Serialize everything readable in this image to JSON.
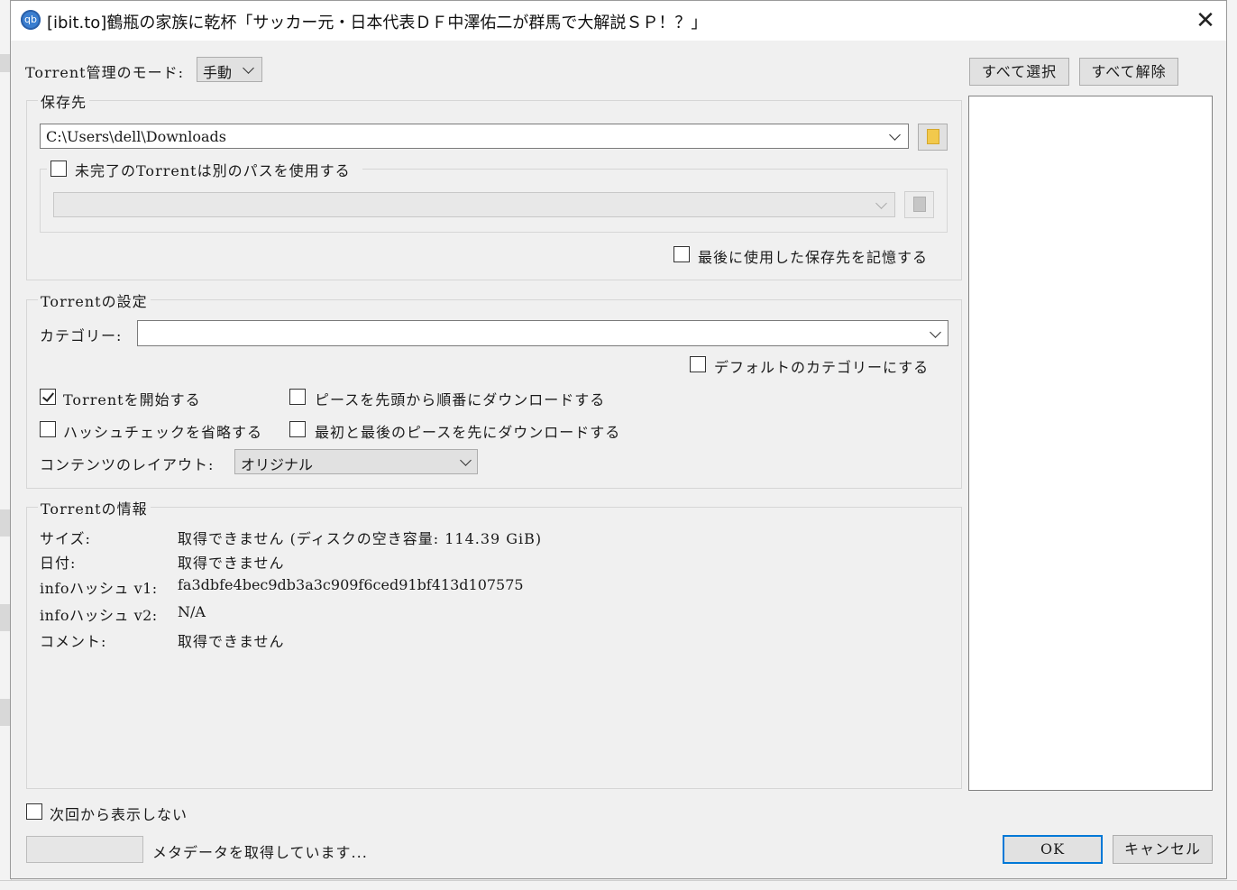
{
  "window": {
    "app_icon_text": "qb",
    "title": "[ibit.to]鶴瓶の家族に乾杯「サッカー元・日本代表ＤＦ中澤佑二が群馬で大解説ＳＰ！？」"
  },
  "mode": {
    "label": "Torrent管理のモード:",
    "value": "手動"
  },
  "save_location": {
    "group_title": "保存先",
    "path": "C:\\Users\\dell\\Downloads",
    "incomplete_label": "未完了のTorrentは別のパスを使用する",
    "incomplete_checked": false,
    "incomplete_path": "",
    "remember_label": "最後に使用した保存先を記憶する",
    "remember_checked": false
  },
  "torrent_settings": {
    "group_title": "Torrentの設定",
    "category_label": "カテゴリー:",
    "category_value": "",
    "default_category_label": "デフォルトのカテゴリーにする",
    "start_label": "Torrentを開始する",
    "start_checked": true,
    "sequential_label": "ピースを先頭から順番にダウンロードする",
    "skip_hash_label": "ハッシュチェックを省略する",
    "first_last_label": "最初と最後のピースを先にダウンロードする",
    "layout_label": "コンテンツのレイアウト:",
    "layout_value": "オリジナル"
  },
  "torrent_info": {
    "group_title": "Torrentの情報",
    "size_label": "サイズ:",
    "size_value": "取得できません (ディスクの空き容量: 114.39 GiB)",
    "date_label": "日付:",
    "date_value": "取得できません",
    "hash_v1_label": "infoハッシュ v1:",
    "hash_v1_value": "fa3dbfe4bec9db3a3c909f6ced91bf413d107575",
    "hash_v2_label": "infoハッシュ v2:",
    "hash_v2_value": "N/A",
    "comment_label": "コメント:",
    "comment_value": "取得できません"
  },
  "file_panel": {
    "select_all": "すべて選択",
    "deselect_all": "すべて解除"
  },
  "footer": {
    "dont_show_label": "次回から表示しない",
    "status": "メタデータを取得しています...",
    "ok": "OK",
    "cancel": "キャンセル"
  }
}
